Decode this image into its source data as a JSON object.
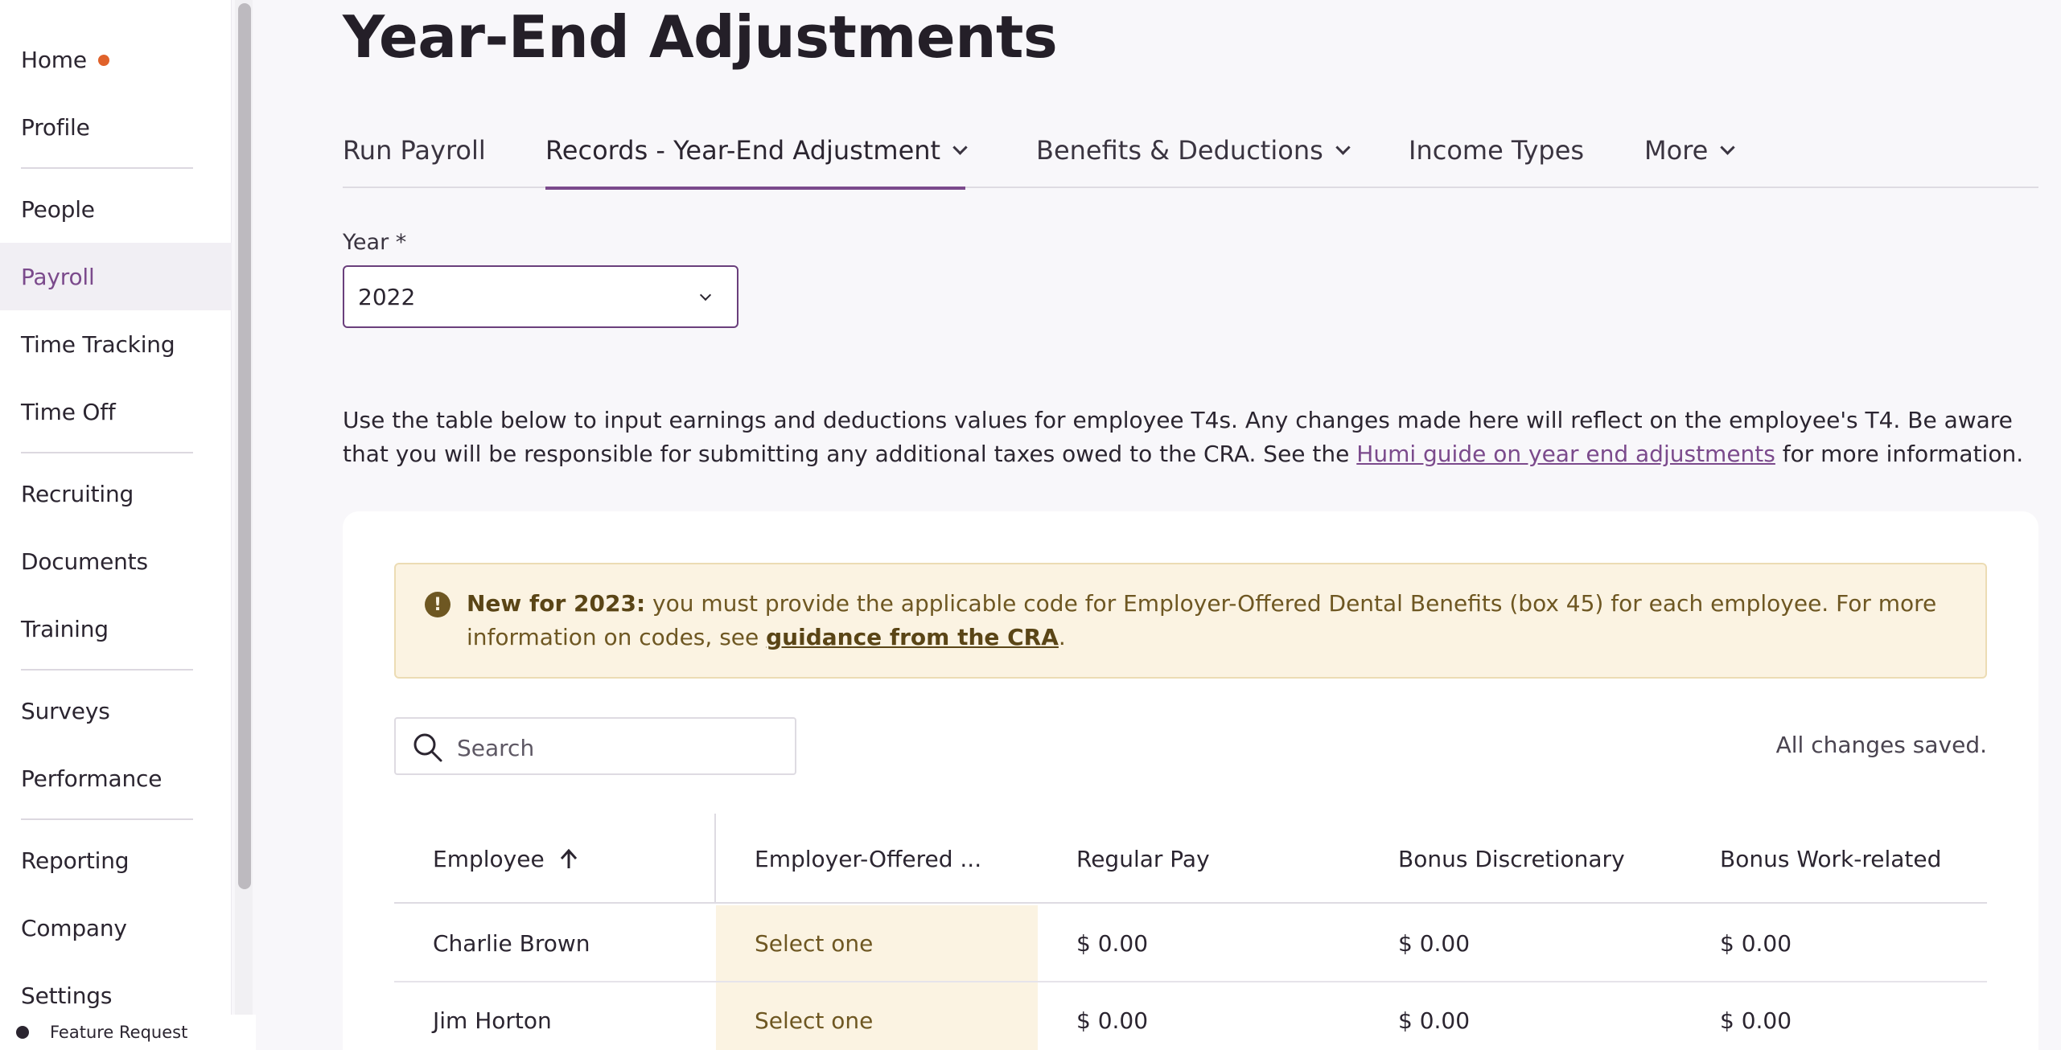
{
  "sidebar": {
    "items": [
      {
        "label": "Home"
      },
      {
        "label": "Profile"
      },
      {
        "label": "People"
      },
      {
        "label": "Payroll"
      },
      {
        "label": "Time Tracking"
      },
      {
        "label": "Time Off"
      },
      {
        "label": "Recruiting"
      },
      {
        "label": "Documents"
      },
      {
        "label": "Training"
      },
      {
        "label": "Surveys"
      },
      {
        "label": "Performance"
      },
      {
        "label": "Reporting"
      },
      {
        "label": "Company"
      },
      {
        "label": "Settings"
      }
    ],
    "active": "Payroll",
    "feature_request": "Feature Request"
  },
  "page": {
    "title": "Year-End Adjustments"
  },
  "tabs": [
    {
      "label": "Run Payroll"
    },
    {
      "label": "Records - Year-End Adjustment"
    },
    {
      "label": "Benefits & Deductions"
    },
    {
      "label": "Income Types"
    },
    {
      "label": "More"
    }
  ],
  "year_field": {
    "label": "Year *",
    "value": "2022"
  },
  "intro": {
    "text_before": "Use the table below to input earnings and deductions values for employee T4s. Any changes made here will reflect on the employee's T4. Be aware that you will be responsible for submitting any additional taxes owed to the CRA. See the ",
    "link": "Humi guide on year end adjustments",
    "text_after": " for more information."
  },
  "alert": {
    "bold": "New for 2023:",
    "text": " you must provide the applicable code for Employer-Offered Dental Benefits (box 45) for each employee. For more information on codes, see ",
    "link": "guidance from the CRA",
    "end": "."
  },
  "search": {
    "placeholder": "Search"
  },
  "status": "All changes saved.",
  "table": {
    "columns": [
      "Employee",
      "Employer-Offered ...",
      "Regular Pay",
      "Bonus Discretionary",
      "Bonus Work-related"
    ],
    "rows": [
      [
        "Charlie Brown",
        "Select one",
        "$ 0.00",
        "$ 0.00",
        "$ 0.00"
      ],
      [
        "Jim Horton",
        "Select one",
        "$ 0.00",
        "$ 0.00",
        "$ 0.00"
      ]
    ]
  },
  "colors": {
    "accent": "#7b4a8c",
    "notification_dot": "#e0622b",
    "alert_bg": "#fbf3e2",
    "alert_text": "#6e5722"
  }
}
